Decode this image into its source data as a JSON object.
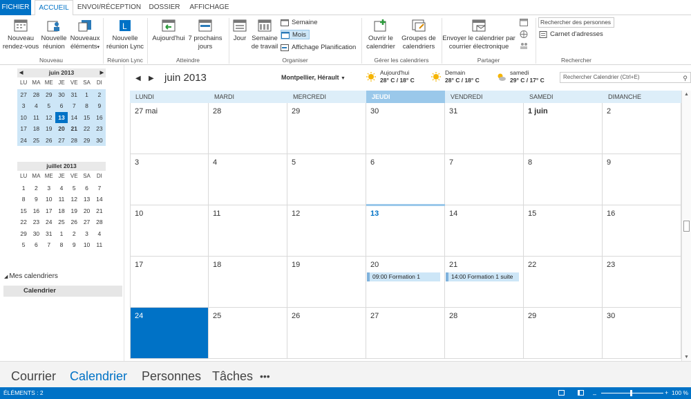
{
  "tabs": [
    "FICHIER",
    "ACCUEIL",
    "ENVOI/RÉCEPTION",
    "DOSSIER",
    "AFFICHAGE"
  ],
  "ribbon": {
    "nouveau_rdv": "Nouveau rendez-vous",
    "nouvelle_reunion": "Nouvelle réunion",
    "nouveaux_elements": "Nouveaux éléments",
    "nouveaux_elements_arrow": "▾",
    "group_nouveau": "Nouveau",
    "reunion_lync": "Nouvelle réunion Lync",
    "group_lync": "Réunion Lync",
    "aujourdhui": "Aujourd'hui",
    "sept_prochains": "7 prochains jours",
    "group_atteindre": "Atteindre",
    "jour": "Jour",
    "semaine_travail": "Semaine de travail",
    "semaine": "Semaine",
    "mois": "Mois",
    "planification": "Affichage Planification",
    "group_organiser": "Organiser",
    "ouvrir_calendrier": "Ouvrir le calendrier",
    "groupes_calendriers": "Groupes de calendriers",
    "group_gerer": "Gérer les calendriers",
    "envoyer_calendrier": "Envoyer le calendrier par courrier électronique",
    "group_partager": "Partager",
    "rechercher_personnes": "Rechercher des personnes",
    "carnet_adresses": "Carnet d'adresses",
    "group_rechercher": "Rechercher"
  },
  "mini_june": {
    "title": "juin 2013",
    "days": [
      "LU",
      "MA",
      "ME",
      "JE",
      "VE",
      "SA",
      "DI"
    ],
    "weeks": [
      [
        "27",
        "28",
        "29",
        "30",
        "31",
        "1",
        "2"
      ],
      [
        "3",
        "4",
        "5",
        "6",
        "7",
        "8",
        "9"
      ],
      [
        "10",
        "11",
        "12",
        "13",
        "14",
        "15",
        "16"
      ],
      [
        "17",
        "18",
        "19",
        "20",
        "21",
        "22",
        "23"
      ],
      [
        "24",
        "25",
        "26",
        "27",
        "28",
        "29",
        "30"
      ]
    ]
  },
  "mini_july": {
    "title": "juillet 2013",
    "days": [
      "LU",
      "MA",
      "ME",
      "JE",
      "VE",
      "SA",
      "DI"
    ],
    "weeks": [
      [
        "1",
        "2",
        "3",
        "4",
        "5",
        "6",
        "7"
      ],
      [
        "8",
        "9",
        "10",
        "11",
        "12",
        "13",
        "14"
      ],
      [
        "15",
        "16",
        "17",
        "18",
        "19",
        "20",
        "21"
      ],
      [
        "22",
        "23",
        "24",
        "25",
        "26",
        "27",
        "28"
      ],
      [
        "29",
        "30",
        "31",
        "1",
        "2",
        "3",
        "4"
      ],
      [
        "5",
        "6",
        "7",
        "8",
        "9",
        "10",
        "11"
      ]
    ]
  },
  "sidebar": {
    "my_calendars": "Mes calendriers",
    "calendar_item": "Calendrier"
  },
  "header": {
    "month_title": "juin 2013",
    "location": "Montpellier, Hérault",
    "weather": [
      {
        "label": "Aujourd'hui",
        "temp": "28° C / 18° C"
      },
      {
        "label": "Demain",
        "temp": "28° C / 18° C"
      },
      {
        "label": "samedi",
        "temp": "29° C / 17° C"
      }
    ],
    "search_placeholder": "Rechercher Calendrier (Ctrl+E)"
  },
  "calendar": {
    "weekdays": [
      "LUNDI",
      "MARDI",
      "MERCREDI",
      "JEUDI",
      "VENDREDI",
      "SAMEDI",
      "DIMANCHE"
    ],
    "weeks": [
      [
        "27 mai",
        "28",
        "29",
        "30",
        "31",
        "1 juin",
        "2"
      ],
      [
        "3",
        "4",
        "5",
        "6",
        "7",
        "8",
        "9"
      ],
      [
        "10",
        "11",
        "12",
        "13",
        "14",
        "15",
        "16"
      ],
      [
        "17",
        "18",
        "19",
        "20",
        "21",
        "22",
        "23"
      ],
      [
        "24",
        "25",
        "26",
        "27",
        "28",
        "29",
        "30"
      ]
    ],
    "events": [
      {
        "week": 3,
        "day": 3,
        "text": "09:00 Formation 1"
      },
      {
        "week": 3,
        "day": 4,
        "text": "14:00 Formation 1 suite"
      }
    ]
  },
  "bottom_nav": [
    "Courrier",
    "Calendrier",
    "Personnes",
    "Tâches",
    "•••"
  ],
  "status": {
    "items": "ÉLÉMENTS : 2",
    "zoom": "100 %"
  },
  "colors": {
    "accent": "#0072c6",
    "shade": "#cde6f7",
    "header_bg": "#ddeef9"
  }
}
